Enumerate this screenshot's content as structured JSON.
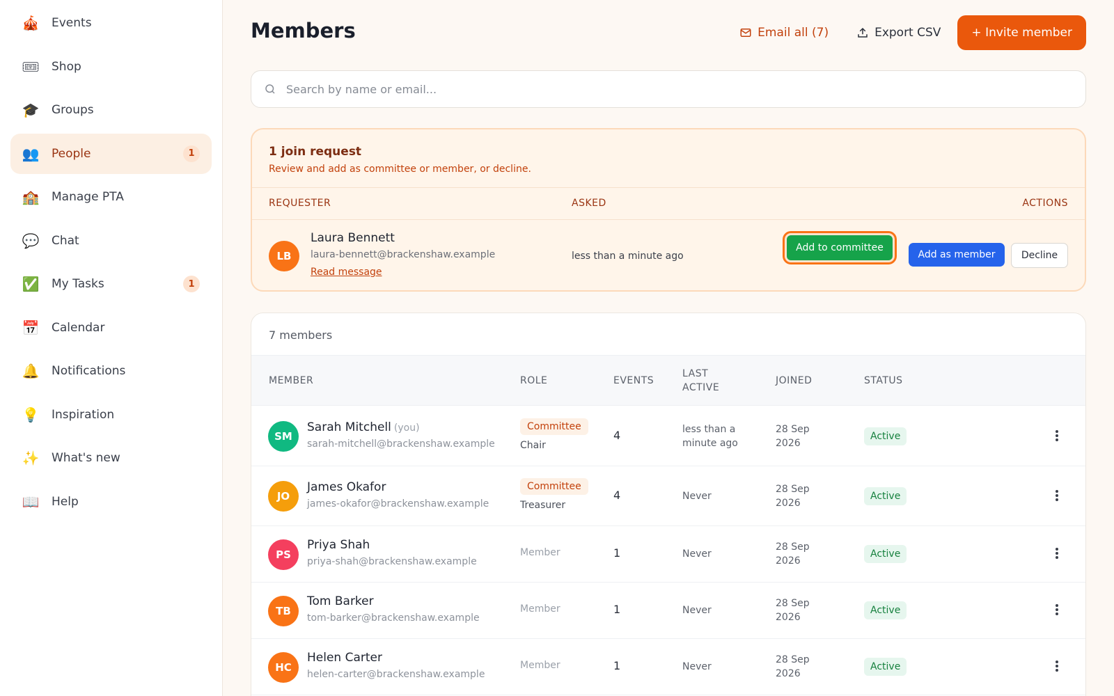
{
  "sidebar": {
    "items": [
      {
        "label": "Events",
        "icon": "🎪",
        "icon_name": "circus-tent-icon"
      },
      {
        "label": "Shop",
        "icon": "🎟",
        "icon_name": "ticket-icon"
      },
      {
        "label": "Groups",
        "icon": "🎓",
        "icon_name": "graduation-cap-icon"
      },
      {
        "label": "People",
        "icon": "👥",
        "icon_name": "people-icon",
        "badge": "1",
        "active": true
      },
      {
        "label": "Manage PTA",
        "icon": "🏫",
        "icon_name": "school-icon"
      },
      {
        "label": "Chat",
        "icon": "💬",
        "icon_name": "speech-bubble-icon"
      },
      {
        "label": "My Tasks",
        "icon": "✅",
        "icon_name": "check-icon",
        "badge": "1"
      },
      {
        "label": "Calendar",
        "icon": "📅",
        "icon_name": "calendar-icon"
      },
      {
        "label": "Notifications",
        "icon": "🔔",
        "icon_name": "bell-icon"
      },
      {
        "label": "Inspiration",
        "icon": "💡",
        "icon_name": "lightbulb-icon"
      },
      {
        "label": "What's new",
        "icon": "✨",
        "icon_name": "sparkles-icon"
      },
      {
        "label": "Help",
        "icon": "📖",
        "icon_name": "book-icon"
      }
    ]
  },
  "header": {
    "title": "Members",
    "email_all": "Email all (7)",
    "export_csv": "Export CSV",
    "invite": "+ Invite member"
  },
  "search": {
    "placeholder": "Search by name or email...",
    "value": ""
  },
  "join_requests": {
    "title": "1 join request",
    "subtitle": "Review and add as committee or member, or decline.",
    "col_requester": "REQUESTER",
    "col_asked": "ASKED",
    "col_actions": "ACTIONS",
    "requester": {
      "initials": "LB",
      "name": "Laura Bennett",
      "email": "laura-bennett@brackenshaw.example",
      "read_message": "Read message",
      "asked": "less than a minute ago"
    },
    "add_committee": "Add to committee",
    "add_member": "Add as member",
    "decline": "Decline"
  },
  "members": {
    "count_label": "7 members",
    "columns": {
      "member": "MEMBER",
      "role": "ROLE",
      "events": "EVENTS",
      "last_active_1": "LAST",
      "last_active_2": "ACTIVE",
      "joined": "JOINED",
      "status": "STATUS"
    },
    "rows": [
      {
        "initials": "SM",
        "name": "Sarah Mitchell",
        "you": "(you)",
        "email": "sarah-mitchell@brackenshaw.example",
        "role_chip": "Committee",
        "role_sub": "Chair",
        "events": "4",
        "last_active": "less than a minute ago",
        "joined": "28 Sep 2026",
        "status": "Active",
        "avatar_color": "#10b981"
      },
      {
        "initials": "JO",
        "name": "James Okafor",
        "you": "",
        "email": "james-okafor@brackenshaw.example",
        "role_chip": "Committee",
        "role_sub": "Treasurer",
        "events": "4",
        "last_active": "Never",
        "joined": "28 Sep 2026",
        "status": "Active",
        "avatar_color": "#f59e0b"
      },
      {
        "initials": "PS",
        "name": "Priya Shah",
        "you": "",
        "email": "priya-shah@brackenshaw.example",
        "role_plain": "Member",
        "events": "1",
        "last_active": "Never",
        "joined": "28 Sep 2026",
        "status": "Active",
        "avatar_color": "#f43f5e"
      },
      {
        "initials": "TB",
        "name": "Tom Barker",
        "you": "",
        "email": "tom-barker@brackenshaw.example",
        "role_plain": "Member",
        "events": "1",
        "last_active": "Never",
        "joined": "28 Sep 2026",
        "status": "Active",
        "avatar_color": "#f97316"
      },
      {
        "initials": "HC",
        "name": "Helen Carter",
        "you": "",
        "email": "helen-carter@brackenshaw.example",
        "role_plain": "Member",
        "events": "1",
        "last_active": "Never",
        "joined": "28 Sep 2026",
        "status": "Active",
        "avatar_color": "#f97316"
      }
    ]
  },
  "colors": {
    "accent": "#ea580c",
    "committee_button": "#16a34a",
    "member_button": "#2563eb",
    "requester_avatar": "#f97316"
  }
}
